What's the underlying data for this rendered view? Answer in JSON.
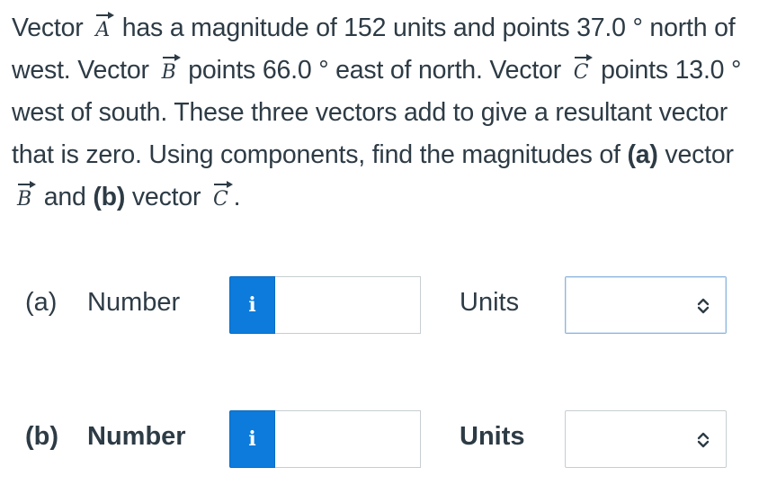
{
  "question": {
    "s1": "Vector",
    "vecA": "A",
    "s2": "has a magnitude of 152 units and points 37.0 ° north of west. Vector",
    "vecB": "B",
    "s3": "points 66.0 ° east of north. Vector",
    "vecC": "C",
    "s4": "points 13.0 ° west of south. These three vectors add to give a resultant vector that is zero. Using components, find the magnitudes of",
    "part_a": "(a)",
    "s5": "vector",
    "vecB2": "B",
    "s6": "and",
    "part_b": "(b)",
    "s7": "vector",
    "vecC2": "C",
    "s8": "."
  },
  "rows": [
    {
      "part": "(a)",
      "number_label": "Number",
      "info_icon": "i",
      "value": "",
      "units_label": "Units",
      "units_value": ""
    },
    {
      "part": "(b)",
      "number_label": "Number",
      "info_icon": "i",
      "value": "",
      "units_label": "Units",
      "units_value": ""
    }
  ],
  "colors": {
    "accent": "#0c7bdc",
    "text": "#2d3b45",
    "border": "#c7cdd1"
  }
}
